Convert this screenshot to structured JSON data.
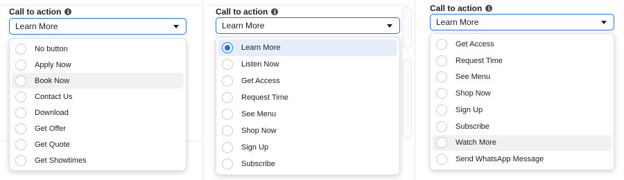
{
  "colors": {
    "accent": "#1b74e4",
    "selected_bg": "#e6edfb",
    "hover_bg": "#f0f1f3",
    "text": "#1c1e21"
  },
  "panels": [
    {
      "header": "Call to action",
      "info_icon": "info-icon",
      "select_value": "Learn More",
      "options": [
        {
          "label": "No button",
          "state": "normal"
        },
        {
          "label": "Apply Now",
          "state": "normal"
        },
        {
          "label": "Book Now",
          "state": "hover"
        },
        {
          "label": "Contact Us",
          "state": "normal"
        },
        {
          "label": "Download",
          "state": "normal"
        },
        {
          "label": "Get Offer",
          "state": "normal"
        },
        {
          "label": "Get Quote",
          "state": "normal"
        },
        {
          "label": "Get Showtimes",
          "state": "normal"
        }
      ]
    },
    {
      "header": "Call to action",
      "info_icon": "info-icon",
      "select_value": "Learn More",
      "options": [
        {
          "label": "Learn More",
          "state": "selected"
        },
        {
          "label": "Listen Now",
          "state": "normal"
        },
        {
          "label": "Get Access",
          "state": "normal"
        },
        {
          "label": "Request Time",
          "state": "normal"
        },
        {
          "label": "See Menu",
          "state": "normal"
        },
        {
          "label": "Shop Now",
          "state": "normal"
        },
        {
          "label": "Sign Up",
          "state": "normal"
        },
        {
          "label": "Subscribe",
          "state": "normal"
        }
      ]
    },
    {
      "header": "Call to action",
      "info_icon": "info-icon",
      "select_value": "Learn More",
      "options": [
        {
          "label": "Get Access",
          "state": "normal"
        },
        {
          "label": "Request Time",
          "state": "normal"
        },
        {
          "label": "See Menu",
          "state": "normal"
        },
        {
          "label": "Shop Now",
          "state": "normal"
        },
        {
          "label": "Sign Up",
          "state": "normal"
        },
        {
          "label": "Subscribe",
          "state": "normal"
        },
        {
          "label": "Watch More",
          "state": "hover"
        },
        {
          "label": "Send WhatsApp Message",
          "state": "normal"
        }
      ]
    }
  ]
}
